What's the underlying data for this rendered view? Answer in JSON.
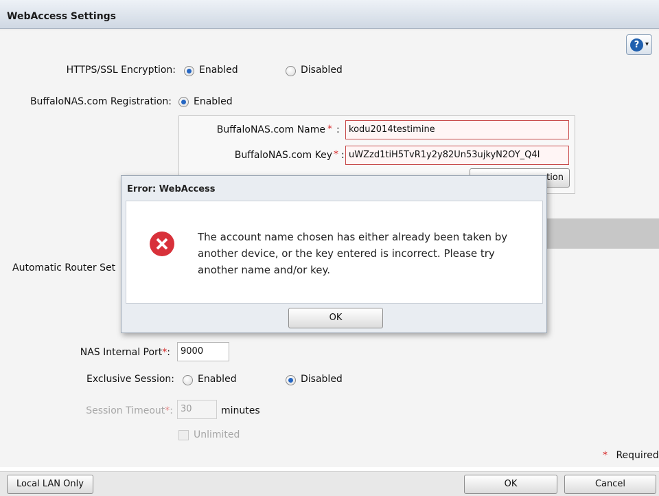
{
  "window": {
    "title": "WebAccess Settings"
  },
  "help": {
    "glyph": "?",
    "dropdown_glyph": "▾"
  },
  "https": {
    "label": "HTTPS/SSL Encryption:",
    "enabled": "Enabled",
    "disabled": "Disabled",
    "selected": "Enabled"
  },
  "registration": {
    "label": "BuffaloNAS.com Registration:",
    "enabled": "Enabled",
    "selected": "Enabled"
  },
  "nas_name": {
    "label": "BuffaloNAS.com Name",
    "value": "kodu2014testimine"
  },
  "nas_key": {
    "label": "BuffaloNAS.com Key",
    "value": "uWZzd1tiH5TvR1y2y82Un53ujkyN2OY_Q4I"
  },
  "required_marker": "*",
  "colon": ":",
  "partial_button": {
    "label": "tion"
  },
  "router_setup": {
    "label": "Automatic Router Set"
  },
  "internal_port": {
    "label": "NAS Internal Port",
    "value": "9000"
  },
  "exclusive": {
    "label": "Exclusive Session:",
    "enabled": "Enabled",
    "disabled": "Disabled",
    "selected": "Disabled"
  },
  "timeout": {
    "label": "Session Timeout",
    "value": "30",
    "unit": "minutes"
  },
  "unlimited": {
    "label": "Unlimited",
    "checked": false
  },
  "required_note": "Required",
  "footer": {
    "local_lan": "Local LAN Only",
    "ok": "OK",
    "cancel": "Cancel"
  },
  "dialog": {
    "title": "Error: WebAccess",
    "message": "The account name chosen has either already been taken by another device, or the key entered is incorrect. Please try another name and/or key.",
    "ok": "OK",
    "icon": "error-icon"
  },
  "colors": {
    "accent": "#2566c2",
    "error": "#d8313a",
    "required": "#d62828"
  }
}
